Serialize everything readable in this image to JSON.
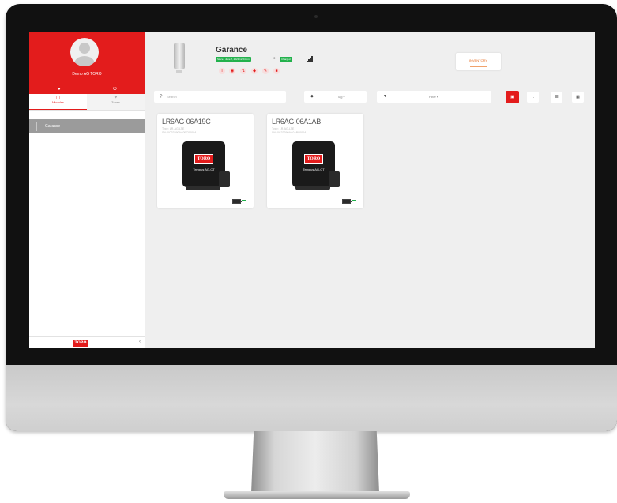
{
  "app": {
    "brand": "TORO",
    "accent_color": "#e31c1c",
    "success_color": "#22b14c"
  },
  "sidebar": {
    "user_name": "Demo AG TORO",
    "profile_icons": [
      "user-icon",
      "power-icon"
    ],
    "tabs": [
      {
        "label": "Modules",
        "icon": "modules-icon",
        "active": true
      },
      {
        "label": "Zones",
        "icon": "zones-icon",
        "active": false
      }
    ],
    "zones": [
      {
        "label": "Garance"
      }
    ],
    "collapse_glyph": "‹"
  },
  "device": {
    "name": "Garance",
    "status_badge": "Since : June 7, 2021 12:04 pm",
    "sep": "∞",
    "state_badge": "Charged",
    "actions": [
      "info-icon",
      "location-icon",
      "sync-icon",
      "tag-icon",
      "edit-icon",
      "delete-icon"
    ]
  },
  "header": {
    "inventory_label": "INVENTORY"
  },
  "toolbar": {
    "search_placeholder": "Search",
    "tag_label": "Tag ▾",
    "filter_label": "Filter ▾",
    "view_buttons": [
      {
        "icon": "large-grid-icon",
        "active": true
      },
      {
        "icon": "small-grid-icon",
        "active": false
      },
      {
        "icon": "list-icon",
        "active": false
      },
      {
        "icon": "map-icon",
        "active": false
      }
    ]
  },
  "cards": [
    {
      "id": "LR6AG-06A19C",
      "type_line": "Type: LR-AG-LTE",
      "sn_line": "SN: 0C33390AA0FC0000A",
      "product": "Tempus AG-CT",
      "logo": "TORO"
    },
    {
      "id": "LR6AG-06A1AB",
      "type_line": "Type: LR-AG-LTE",
      "sn_line": "SN: 0C33390AA0AB0000A",
      "product": "Tempus AG-CT",
      "logo": "TORO"
    }
  ]
}
